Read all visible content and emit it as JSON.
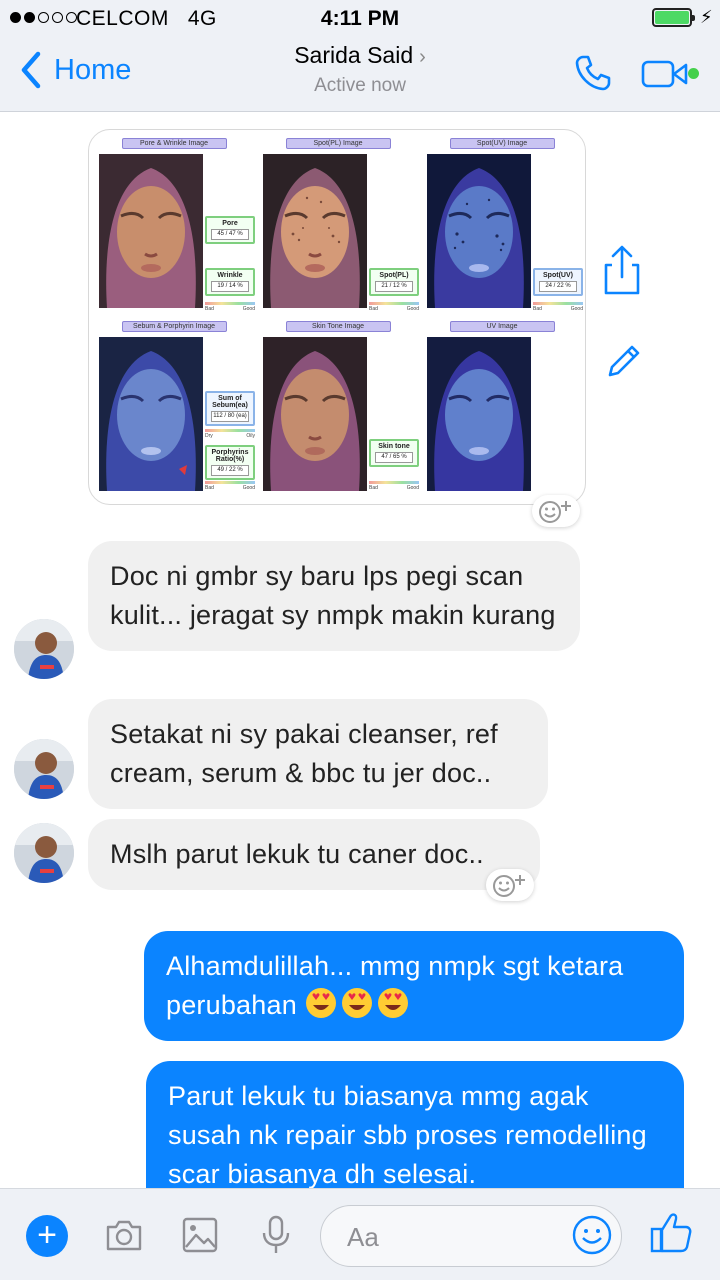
{
  "status_bar": {
    "carrier": "CELCOM",
    "network": "4G",
    "time": "4:11 PM",
    "signal_bars_filled": 2,
    "signal_bars_total": 5,
    "battery_level": 1.0
  },
  "header": {
    "back_label": "Home",
    "contact_name": "Sarida Said",
    "contact_status": "Active now",
    "accent_color": "#0b84ff",
    "online_color": "#44d04b"
  },
  "scan_report": {
    "panels": [
      {
        "title": "Pore & Wrinkle Image",
        "metrics": [
          {
            "name": "Pore",
            "value": "45 / 47 %"
          },
          {
            "name": "Wrinkle",
            "value": "19 / 14 %"
          }
        ],
        "scale": [
          "Bad",
          "Good"
        ]
      },
      {
        "title": "Spot(PL) Image",
        "metrics": [
          {
            "name": "Spot(PL)",
            "value": "21 / 12 %"
          }
        ],
        "scale": [
          "Bad",
          "Good"
        ]
      },
      {
        "title": "Spot(UV) Image",
        "metrics": [
          {
            "name": "Spot(UV)",
            "value": "24 / 22 %"
          }
        ],
        "scale": [
          "Bad",
          "Good"
        ]
      },
      {
        "title": "Sebum & Porphyrin Image",
        "metrics": [
          {
            "name": "Sum of Sebum(ea)",
            "value": "112 / 80 (ea)"
          },
          {
            "name": "Porphyrins Ratio(%)",
            "value": "49 / 22 %"
          }
        ],
        "scale": [
          "Dry",
          "Oily",
          "Bad",
          "Good"
        ]
      },
      {
        "title": "Skin Tone Image",
        "metrics": [
          {
            "name": "Skin tone",
            "value": "47 / 65 %"
          }
        ],
        "scale": [
          "Bad",
          "Good"
        ]
      },
      {
        "title": "UV Image",
        "metrics": [],
        "scale": []
      }
    ]
  },
  "messages": [
    {
      "from": "contact",
      "text": "Doc ni gmbr sy baru lps pegi scan kulit... jeragat sy nmpk makin kurang"
    },
    {
      "from": "contact",
      "text": "Setakat ni sy pakai cleanser, ref cream, serum & bbc tu jer doc.."
    },
    {
      "from": "contact",
      "text": "Mslh parut lekuk tu caner doc.."
    },
    {
      "from": "me",
      "text": "Alhamdulillah... mmg nmpk sgt ketara perubahan",
      "emoji_count": 3
    },
    {
      "from": "me",
      "text": "Parut lekuk tu biasanya mmg agak susah nk repair sbb proses remodelling scar biasanya dh selesai."
    }
  ],
  "composer": {
    "placeholder": "Aa"
  },
  "icons": {
    "back": "chevron-left-icon",
    "call": "phone-icon",
    "video": "video-camera-icon",
    "share": "share-icon",
    "edit": "pencil-icon",
    "react": "add-reaction-icon",
    "add": "plus-icon",
    "camera": "camera-icon",
    "gallery": "image-icon",
    "voice": "microphone-icon",
    "emoji": "emoji-icon",
    "like": "thumbs-up-icon"
  }
}
